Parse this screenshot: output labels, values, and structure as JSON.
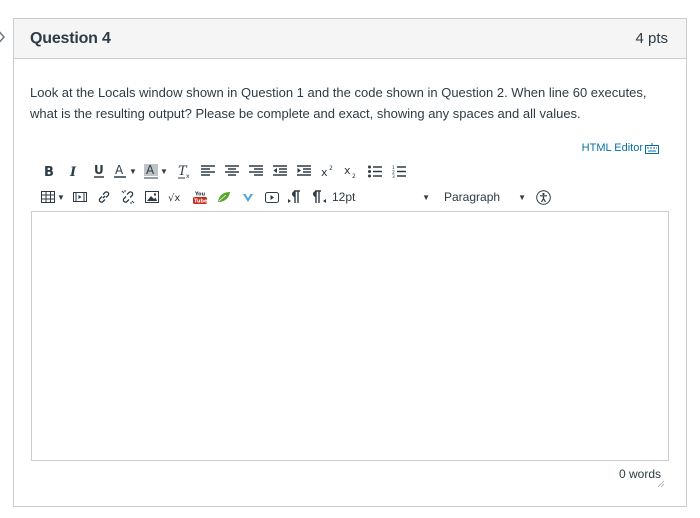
{
  "question": {
    "title": "Question 4",
    "points": "4 pts",
    "text": "Look at the Locals window shown in Question 1 and the code shown in Question 2.  When line 60 executes, what is the resulting output? Please be complete and exact, showing any spaces and all values."
  },
  "editor": {
    "html_editor_label": "HTML Editor",
    "font_size": "12pt",
    "block_format": "Paragraph",
    "word_count": "0 words",
    "toolbar_row1": [
      "bold-icon",
      "italic-icon",
      "underline-icon",
      "text-color-icon",
      "background-color-icon",
      "clear-formatting-icon",
      "align-left-icon",
      "align-center-icon",
      "align-right-icon",
      "outdent-icon",
      "indent-icon",
      "superscript-icon",
      "subscript-icon",
      "bullet-list-icon",
      "numbered-list-icon"
    ],
    "toolbar_row2": [
      "table-icon",
      "media-icon",
      "link-icon",
      "unlink-icon",
      "image-icon",
      "math-icon",
      "youtube-icon",
      "leaf-icon",
      "vimeo-icon",
      "video-icon",
      "ltr-icon",
      "rtl-icon",
      "font-size-select",
      "paragraph-select",
      "accessibility-icon"
    ]
  },
  "colors": {
    "link": "#0770a3",
    "text": "#2d3b45",
    "border": "#c7cdd1",
    "header_bg": "#f5f5f5",
    "youtube": "#cc2a1b",
    "leaf": "#55a629",
    "vimeo": "#4aa4d9"
  }
}
